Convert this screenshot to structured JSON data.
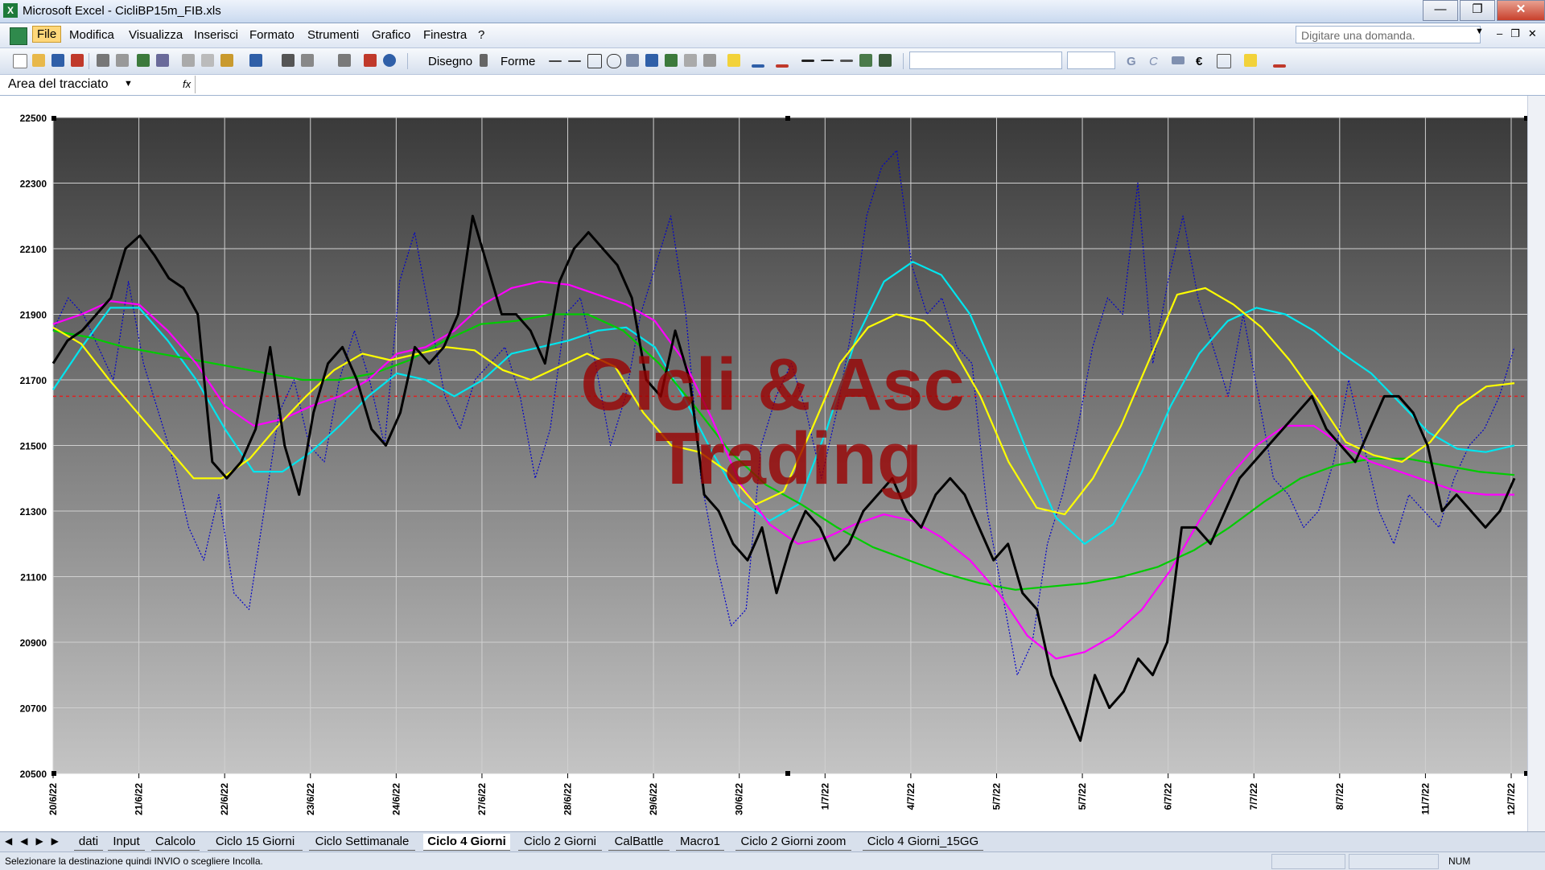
{
  "window": {
    "title": "Microsoft Excel - CicliBP15m_FIB.xls",
    "app_icon": "excel-icon",
    "controls": [
      "minimize-icon",
      "maximize-icon",
      "close-icon"
    ]
  },
  "menubar": {
    "items": [
      "File",
      "Modifica",
      "Visualizza",
      "Inserisci",
      "Formato",
      "Strumenti",
      "Grafico",
      "Finestra",
      "?"
    ],
    "active": "File",
    "ask_placeholder": "Digitare una domanda."
  },
  "toolbar": {
    "draw_label": "Disegno",
    "shapes_label": "Forme",
    "bold_label": "G",
    "italic_label": "C"
  },
  "formula_bar": {
    "name_box": "Area del tracciato",
    "fx_label": "fx"
  },
  "chart_data": {
    "type": "line",
    "watermark": [
      "Cicli & Asc",
      "Trading"
    ],
    "ylim": [
      20500,
      22500
    ],
    "y_ticks": [
      22500,
      22300,
      22100,
      21900,
      21700,
      21500,
      21300,
      21100,
      20900,
      20700,
      20500
    ],
    "x_labels": [
      "20/6/22",
      "21/6/22",
      "22/6/22",
      "23/6/22",
      "24/6/22",
      "27/6/22",
      "28/6/22",
      "29/6/22",
      "30/6/22",
      "1/7/22",
      "4/7/22",
      "5/7/22",
      "5/7/22",
      "6/7/22",
      "7/7/22",
      "8/7/22",
      "11/7/22",
      "12/7/22"
    ],
    "reference_line": 21650,
    "grid": true,
    "series": [
      {
        "color": "#000000",
        "style": "bold",
        "values": [
          21750,
          21820,
          21850,
          21900,
          21950,
          22100,
          22140,
          22080,
          22010,
          21980,
          21900,
          21450,
          21400,
          21450,
          21550,
          21800,
          21500,
          21350,
          21600,
          21750,
          21800,
          21700,
          21550,
          21500,
          21600,
          21800,
          21750,
          21800,
          21900,
          22200,
          22050,
          21900,
          21900,
          21850,
          21750,
          22000,
          22100,
          22150,
          22100,
          22050,
          21950,
          21700,
          21650,
          21850,
          21700,
          21350,
          21300,
          21200,
          21150,
          21250,
          21050,
          21200,
          21300,
          21250,
          21150,
          21200,
          21300,
          21350,
          21400,
          21300,
          21250,
          21350,
          21400,
          21350,
          21250,
          21150,
          21200,
          21050,
          21000,
          20800,
          20700,
          20600,
          20800,
          20700,
          20750,
          20850,
          20800,
          20900,
          21250,
          21250,
          21200,
          21300,
          21400,
          21450,
          21500,
          21550,
          21600,
          21650,
          21550,
          21500,
          21450,
          21550,
          21650,
          21650,
          21600,
          21500,
          21300,
          21350,
          21300,
          21250,
          21300,
          21400
        ]
      },
      {
        "color": "#0000cc",
        "style": "dotted",
        "values": [
          21850,
          21950,
          21900,
          21800,
          21700,
          22000,
          21750,
          21600,
          21450,
          21250,
          21150,
          21350,
          21050,
          21000,
          21300,
          21600,
          21700,
          21500,
          21450,
          21700,
          21850,
          21700,
          21500,
          22000,
          22150,
          21900,
          21650,
          21550,
          21700,
          21750,
          21800,
          21650,
          21400,
          21550,
          21900,
          21950,
          21750,
          21500,
          21650,
          21900,
          22050,
          22200,
          21900,
          21400,
          21150,
          20950,
          21000,
          21500,
          21650,
          21750,
          21600,
          21400,
          21600,
          21850,
          22200,
          22350,
          22400,
          22050,
          21900,
          21950,
          21800,
          21750,
          21300,
          21050,
          20800,
          20900,
          21200,
          21350,
          21550,
          21800,
          21950,
          21900,
          22300,
          21750,
          22000,
          22200,
          21950,
          21800,
          21650,
          21900,
          21650,
          21400,
          21350,
          21250,
          21300,
          21450,
          21700,
          21500,
          21300,
          21200,
          21350,
          21300,
          21250,
          21400,
          21500,
          21550,
          21650,
          21800
        ]
      },
      {
        "color": "#ff00ff",
        "style": "solid",
        "values": [
          21870,
          21900,
          21940,
          21930,
          21850,
          21750,
          21620,
          21560,
          21580,
          21620,
          21650,
          21700,
          21780,
          21800,
          21850,
          21930,
          21980,
          22000,
          21990,
          21960,
          21930,
          21880,
          21760,
          21580,
          21380,
          21260,
          21200,
          21220,
          21260,
          21290,
          21270,
          21220,
          21150,
          21050,
          20920,
          20850,
          20870,
          20920,
          21000,
          21120,
          21270,
          21400,
          21500,
          21560,
          21560,
          21500,
          21450,
          21420,
          21390,
          21360,
          21350,
          21350
        ]
      },
      {
        "color": "#00cc00",
        "style": "solid",
        "values": [
          21850,
          21830,
          21800,
          21780,
          21760,
          21740,
          21720,
          21700,
          21700,
          21720,
          21760,
          21820,
          21870,
          21880,
          21900,
          21900,
          21850,
          21750,
          21620,
          21480,
          21380,
          21320,
          21250,
          21190,
          21150,
          21110,
          21080,
          21060,
          21070,
          21080,
          21100,
          21130,
          21180,
          21250,
          21330,
          21400,
          21440,
          21460,
          21460,
          21440,
          21420,
          21410
        ]
      },
      {
        "color": "#00e5ee",
        "style": "solid",
        "values": [
          21670,
          21800,
          21920,
          21920,
          21820,
          21700,
          21550,
          21420,
          21420,
          21480,
          21560,
          21650,
          21720,
          21700,
          21650,
          21700,
          21780,
          21800,
          21820,
          21850,
          21860,
          21800,
          21650,
          21480,
          21330,
          21270,
          21320,
          21550,
          21820,
          22000,
          22060,
          22020,
          21900,
          21700,
          21480,
          21280,
          21200,
          21260,
          21420,
          21620,
          21780,
          21880,
          21920,
          21900,
          21850,
          21780,
          21720,
          21630,
          21540,
          21490,
          21480,
          21500
        ]
      },
      {
        "color": "#ffff00",
        "style": "solid",
        "values": [
          21860,
          21810,
          21700,
          21600,
          21500,
          21400,
          21400,
          21460,
          21560,
          21650,
          21730,
          21780,
          21760,
          21780,
          21800,
          21790,
          21730,
          21700,
          21740,
          21780,
          21740,
          21600,
          21500,
          21480,
          21420,
          21320,
          21360,
          21550,
          21750,
          21860,
          21900,
          21880,
          21800,
          21650,
          21450,
          21310,
          21290,
          21400,
          21560,
          21760,
          21960,
          21980,
          21930,
          21860,
          21760,
          21640,
          21510,
          21470,
          21450,
          21510,
          21620,
          21680,
          21690
        ]
      }
    ]
  },
  "sheet_tabs": {
    "tabs": [
      "dati",
      "Input",
      "Calcolo",
      "Ciclo 15 Giorni",
      "Ciclo Settimanale",
      "Ciclo 4 Giorni",
      "Ciclo 2 Giorni",
      "CalBattle",
      "Macro1",
      "Ciclo 2 Giorni zoom",
      "Ciclo 4 Giorni_15GG"
    ],
    "active": "Ciclo 4 Giorni"
  },
  "status": {
    "message": "Selezionare la destinazione quindi INVIO o scegliere Incolla.",
    "num": "NUM"
  }
}
